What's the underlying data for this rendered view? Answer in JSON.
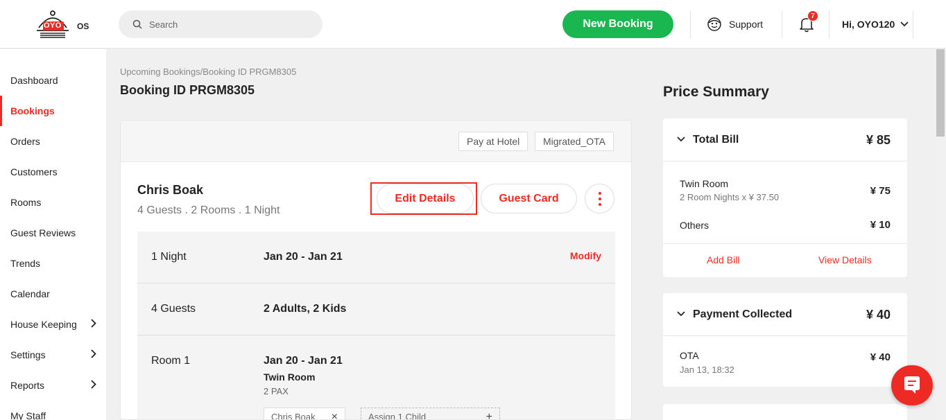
{
  "header": {
    "logo_text": "OYO",
    "logo_suffix": "OS",
    "search_placeholder": "Search",
    "new_booking": "New Booking",
    "support": "Support",
    "notification_count": "7",
    "user_greeting": "Hi, OYO120"
  },
  "sidebar": {
    "items": [
      {
        "label": "Dashboard"
      },
      {
        "label": "Bookings"
      },
      {
        "label": "Orders"
      },
      {
        "label": "Customers"
      },
      {
        "label": "Rooms"
      },
      {
        "label": "Guest Reviews"
      },
      {
        "label": "Trends"
      },
      {
        "label": "Calendar"
      },
      {
        "label": "House Keeping"
      },
      {
        "label": "Settings"
      },
      {
        "label": "Reports"
      },
      {
        "label": "My Staff"
      }
    ]
  },
  "main": {
    "breadcrumb": "Upcoming Bookings",
    "breadcrumb_sep": "/",
    "breadcrumb_current": "Booking ID PRGM8305",
    "title": "Booking ID PRGM8305",
    "tags": [
      "Pay at Hotel",
      "Migrated_OTA"
    ],
    "guest_name": "Chris Boak",
    "guest_summary": "4 Guests . 2 Rooms . 1 Night",
    "edit_details": "Edit Details",
    "guest_card": "Guest Card",
    "stay": {
      "night_label": "1 Night",
      "dates": "Jan 20 - Jan 21",
      "modify": "Modify",
      "guests_label": "4 Guests",
      "guests_value": "2 Adults, 2 Kids",
      "room_label": "Room 1",
      "room_dates": "Jan 20 - Jan 21",
      "room_type": "Twin Room",
      "room_pax": "2 PAX",
      "assigned_guest": "Chris Boak",
      "assign_child": "Assign 1 Child"
    }
  },
  "price_summary": {
    "title": "Price Summary",
    "total_bill_label": "Total Bill",
    "total_bill_amount": "¥ 85",
    "room_line": "Twin Room",
    "room_line_detail": "2 Room Nights x ¥ 37.50",
    "room_line_amount": "¥ 75",
    "others_label": "Others",
    "others_amount": "¥ 10",
    "add_bill": "Add Bill",
    "view_details": "View Details",
    "payment_label": "Payment Collected",
    "payment_amount": "¥ 40",
    "payment_source": "OTA",
    "payment_date": "Jan 13, 18:32",
    "payment_source_amount": "¥ 40"
  },
  "colors": {
    "brand_red": "#ee2a24",
    "booking_green": "#1ab64f"
  }
}
